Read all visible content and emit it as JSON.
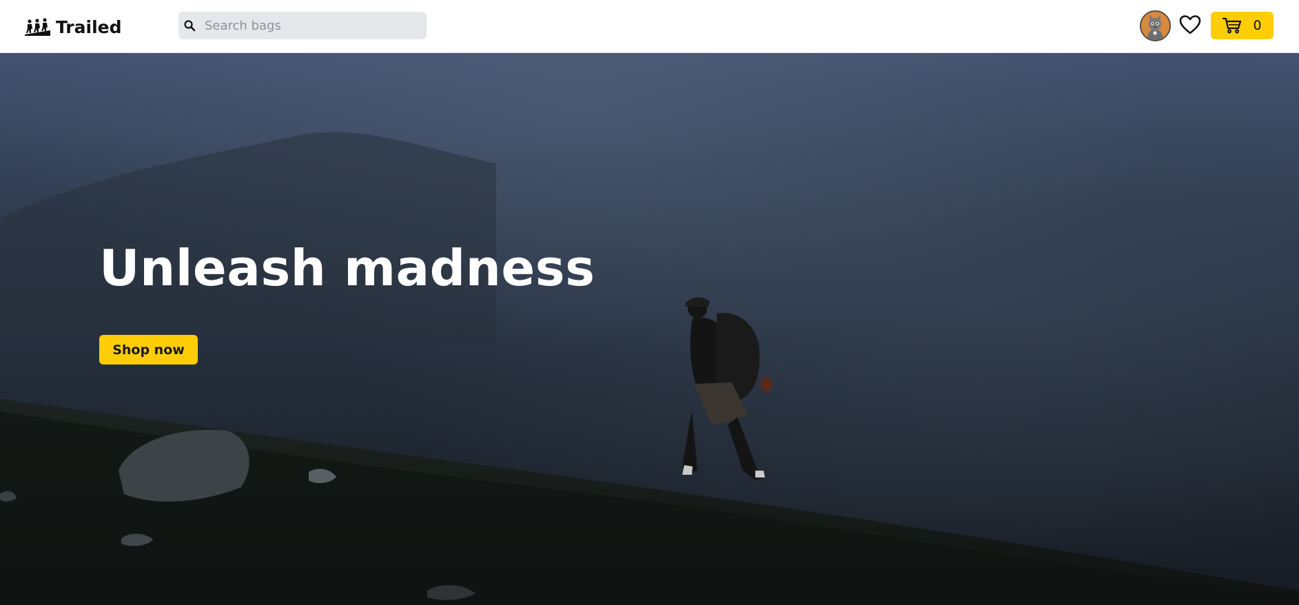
{
  "brand": {
    "name": "Trailed",
    "logo_icon": "hikers-logo-icon"
  },
  "search": {
    "placeholder": "Search bags",
    "value": "",
    "icon": "search-icon"
  },
  "header_actions": {
    "avatar_icon": "cat-avatar-icon",
    "wishlist_icon": "heart-icon",
    "cart_icon": "cart-icon",
    "cart_count": "0"
  },
  "hero": {
    "title": "Unleash madness",
    "cta_label": "Shop now"
  },
  "colors": {
    "accent": "#ffcd05",
    "header_bg": "#ffffff",
    "search_bg": "#e6e7ea",
    "hero_text": "#ffffff"
  }
}
